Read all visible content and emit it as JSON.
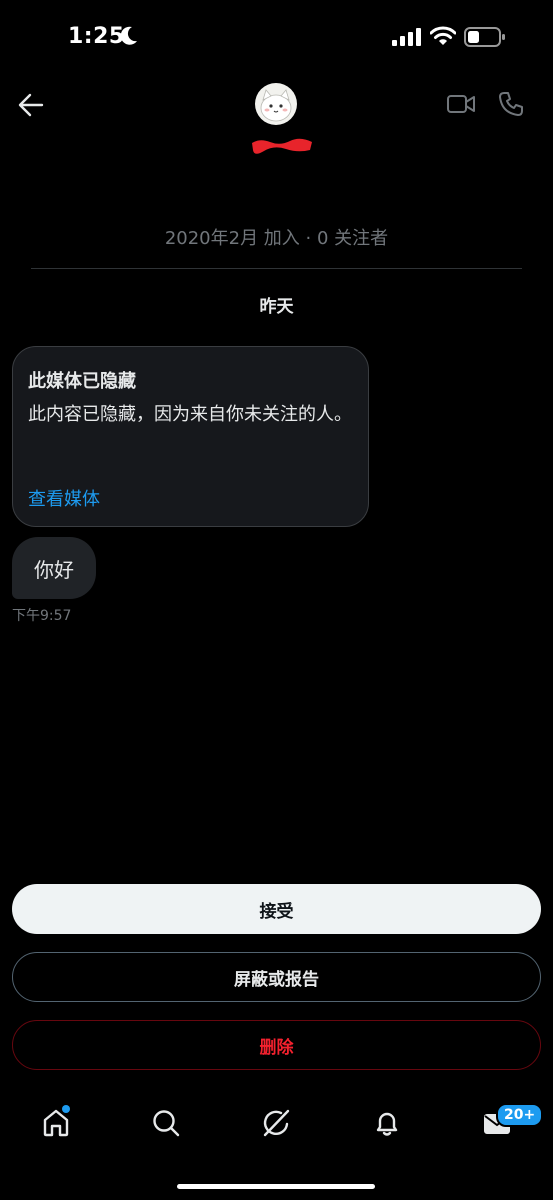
{
  "status_bar": {
    "time": "1:25"
  },
  "header": {
    "joined_text": "2020年2月 加入 · 0 关注者"
  },
  "conversation": {
    "day_label": "昨天",
    "hidden_media_card": {
      "title": "此媒体已隐藏",
      "body": "此内容已隐藏，因为来自你未关注的人。",
      "link": "查看媒体"
    },
    "message": {
      "text": "你好",
      "time": "下午9:57"
    }
  },
  "actions": {
    "accept": "接受",
    "block_or_report": "屏蔽或报告",
    "delete": "删除"
  },
  "bottom_nav": {
    "messages_badge": "20+"
  },
  "colors": {
    "background": "#000000",
    "accent_blue": "#1d9bf0",
    "danger_red": "#f4212e"
  }
}
